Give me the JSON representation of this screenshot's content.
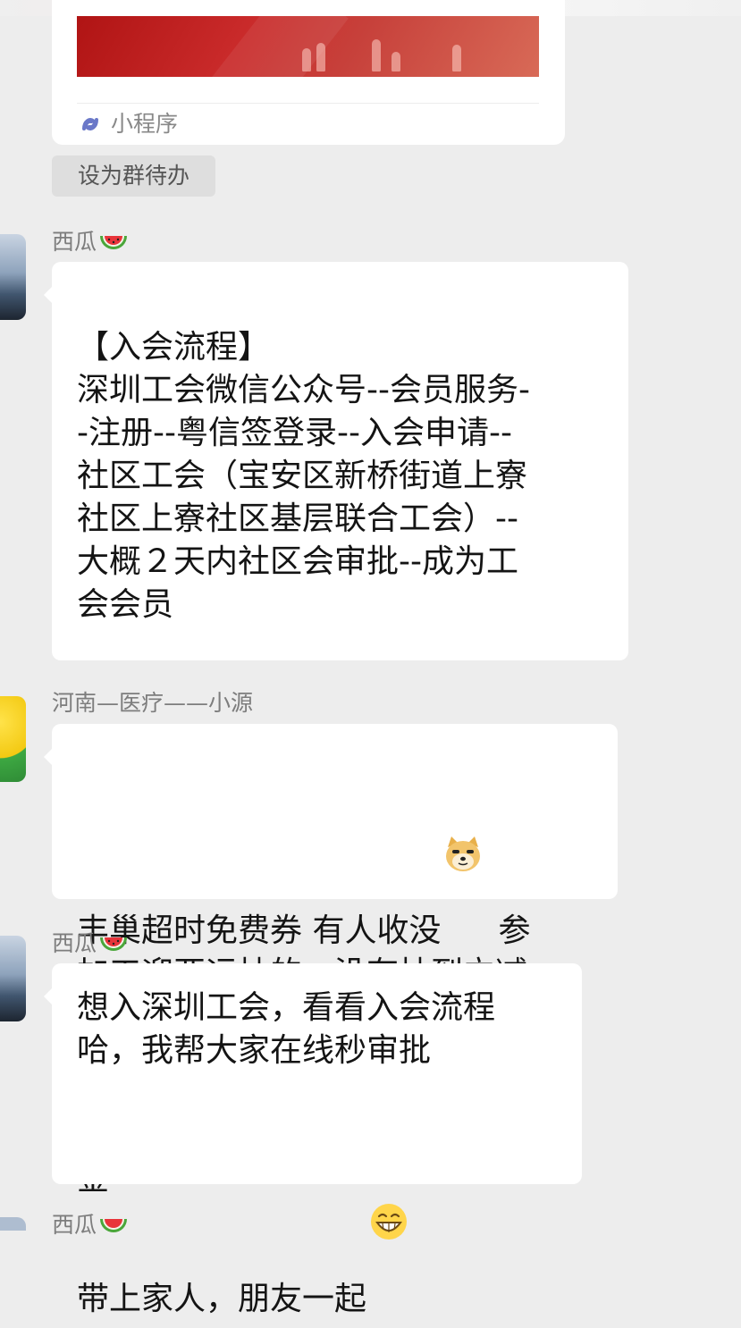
{
  "mini_program": {
    "label": "小程序",
    "icon": "mini-program-link-icon"
  },
  "todo_chip": {
    "label": "设为群待办"
  },
  "messages": [
    {
      "sender": "西瓜",
      "sender_icon": "watermelon-icon",
      "lines": [
        "【入会流程】",
        "深圳工会微信公众号--会员服务-",
        "-注册--粤信签登录--入会申请--",
        "社区工会（宝安区新桥街道上寮",
        "社区上寮社区基层联合工会）--",
        "大概２天内社区会审批--成为工",
        "会会员"
      ]
    },
    {
      "sender": "河南—医疗——小源",
      "line1_text": "丰巢超时免费券 有人收没",
      "line1_icon": "doge-emoji-icon",
      "line1_after": "参",
      "line2": "加工迎亚运抽的，没有抽到立减",
      "line3_text": "金",
      "line3_icon": "crying-face-emoji-icon"
    },
    {
      "sender": "西瓜",
      "sender_icon": "watermelon-icon",
      "line1": "想入深圳工会，看看入会流程",
      "line2": "哈，我帮大家在线秒审批",
      "line3_text": "带上家人，朋友一起",
      "line3_icon": "grinning-face-emoji-icon"
    },
    {
      "sender": "西瓜",
      "sender_icon": "watermelon-icon"
    }
  ],
  "colors": {
    "background": "#ededed",
    "bubble": "#ffffff",
    "sender_name": "#7d7d7d",
    "mini_image_red": "#c92a2a"
  }
}
